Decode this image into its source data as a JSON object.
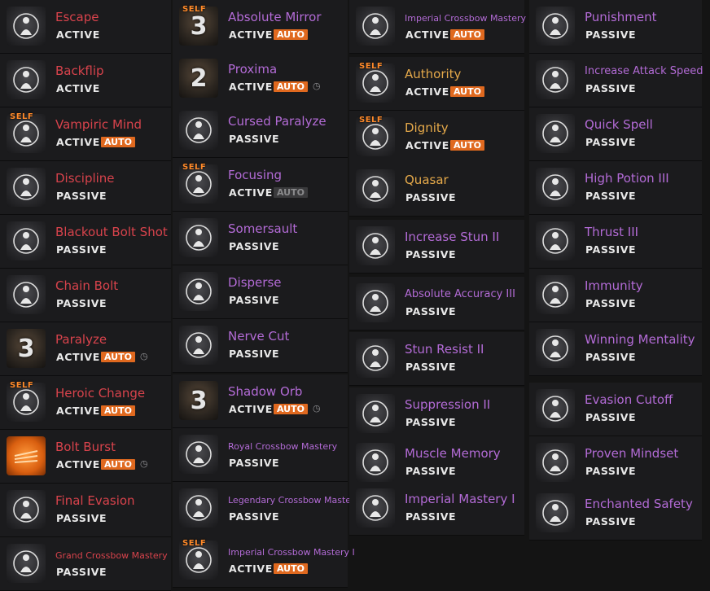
{
  "columns": [
    {
      "skills": [
        {
          "name": "Escape",
          "status": "ACTIVE",
          "color": "red",
          "icon": "escape-icon"
        },
        {
          "name": "Backflip",
          "status": "ACTIVE",
          "color": "red",
          "icon": "backflip-icon"
        },
        {
          "name": "Vampiric Mind",
          "status": "ACTIVE",
          "auto": "AUTO",
          "color": "red",
          "icon": "vampiric-mind-icon",
          "self": "SELF"
        },
        {
          "name": "Discipline",
          "status": "PASSIVE",
          "color": "red",
          "icon": "discipline-icon"
        },
        {
          "name": "Blackout Bolt Shot",
          "status": "PASSIVE",
          "color": "red",
          "icon": "blackout-bolt-icon"
        },
        {
          "name": "Chain Bolt",
          "status": "PASSIVE",
          "color": "red",
          "icon": "chain-bolt-icon"
        },
        {
          "name": "Paralyze",
          "status": "ACTIVE",
          "auto": "AUTO",
          "color": "red",
          "icon": "paralyze-icon",
          "digit": "3",
          "clock": "◷"
        },
        {
          "name": "Heroic Change",
          "status": "ACTIVE",
          "auto": "AUTO",
          "color": "red",
          "icon": "heroic-change-icon",
          "self": "SELF"
        },
        {
          "name": "Bolt Burst",
          "status": "ACTIVE",
          "auto": "AUTO",
          "color": "red",
          "icon": "bolt-burst-icon",
          "clock": "◷",
          "orange": true
        },
        {
          "name": "Final Evasion",
          "status": "PASSIVE",
          "color": "red",
          "icon": "final-evasion-icon"
        },
        {
          "name": "Grand Crossbow Mastery",
          "status": "PASSIVE",
          "color": "red",
          "icon": "grand-crossbow-icon",
          "size": "small"
        }
      ]
    },
    {
      "skills": [
        {
          "name": "Absolute Mirror",
          "status": "ACTIVE",
          "auto": "AUTO",
          "color": "purple",
          "icon": "absolute-mirror-icon",
          "digit": "3",
          "self": "SELF"
        },
        {
          "name": "Proxima",
          "status": "ACTIVE",
          "auto": "AUTO",
          "color": "purple",
          "icon": "proxima-icon",
          "digit": "2",
          "clock": "◷"
        },
        {
          "name": "Cursed Paralyze",
          "status": "PASSIVE",
          "color": "purple",
          "icon": "cursed-paralyze-icon"
        },
        {
          "name": "Focusing",
          "status": "ACTIVE",
          "auto": "AUTO",
          "autoDim": true,
          "color": "purple",
          "icon": "focusing-icon",
          "self": "SELF"
        },
        {
          "name": "Somersault",
          "status": "PASSIVE",
          "color": "purple",
          "icon": "somersault-icon"
        },
        {
          "name": "Disperse",
          "status": "PASSIVE",
          "color": "purple",
          "icon": "disperse-icon"
        },
        {
          "name": "Nerve Cut",
          "status": "PASSIVE",
          "color": "purple",
          "icon": "nerve-cut-icon"
        },
        {
          "name": "Shadow Orb",
          "status": "ACTIVE",
          "auto": "AUTO",
          "color": "purple",
          "icon": "shadow-orb-icon",
          "digit": "3",
          "clock": "◷"
        },
        {
          "name": "Royal Crossbow Mastery",
          "status": "PASSIVE",
          "color": "purple",
          "icon": "royal-crossbow-icon",
          "size": "small"
        },
        {
          "name": "Legendary Crossbow Mastery",
          "status": "PASSIVE",
          "color": "purple",
          "icon": "legendary-crossbow-icon",
          "size": "small"
        },
        {
          "name": "Imperial Crossbow Mastery I",
          "status": "ACTIVE",
          "auto": "AUTO",
          "color": "purple",
          "icon": "imperial-crossbow-icon",
          "size": "small",
          "self": "SELF"
        }
      ]
    },
    {
      "skills": [
        {
          "name": "Imperial Crossbow Mastery II",
          "status": "ACTIVE",
          "auto": "AUTO",
          "color": "purple",
          "icon": "imperial-crossbow-ii-icon",
          "size": "small"
        },
        {
          "name": "Authority",
          "status": "ACTIVE",
          "auto": "AUTO",
          "color": "gold",
          "icon": "authority-icon",
          "self": "SELF"
        },
        {
          "name": "Dignity",
          "status": "ACTIVE",
          "auto": "AUTO",
          "color": "gold",
          "icon": "dignity-icon",
          "self": "SELF"
        },
        {
          "name": "Quasar",
          "status": "PASSIVE",
          "color": "gold",
          "icon": "quasar-icon"
        },
        {
          "name": "Increase Stun II",
          "status": "PASSIVE",
          "color": "purple",
          "icon": "increase-stun-icon"
        },
        {
          "name": "Absolute Accuracy III",
          "status": "PASSIVE",
          "color": "purple",
          "icon": "absolute-accuracy-icon",
          "size": "mid"
        },
        {
          "name": "Stun Resist II",
          "status": "PASSIVE",
          "color": "purple",
          "icon": "stun-resist-icon"
        },
        {
          "name": "Suppression II",
          "status": "PASSIVE",
          "color": "purple",
          "icon": "suppression-icon"
        },
        {
          "name": "Muscle Memory",
          "status": "PASSIVE",
          "color": "purple",
          "icon": "muscle-memory-icon"
        },
        {
          "name": "Imperial Mastery I",
          "status": "PASSIVE",
          "color": "purple",
          "icon": "imperial-mastery-icon"
        }
      ]
    },
    {
      "skills": [
        {
          "name": "Punishment",
          "status": "PASSIVE",
          "color": "purple",
          "icon": "punishment-icon"
        },
        {
          "name": "Increase Attack Speed",
          "status": "PASSIVE",
          "color": "purple",
          "icon": "increase-attack-speed-icon",
          "size": "mid"
        },
        {
          "name": "Quick Spell",
          "status": "PASSIVE",
          "color": "purple",
          "icon": "quick-spell-icon"
        },
        {
          "name": "High Potion III",
          "status": "PASSIVE",
          "color": "purple",
          "icon": "high-potion-icon"
        },
        {
          "name": "Thrust III",
          "status": "PASSIVE",
          "color": "purple",
          "icon": "thrust-icon"
        },
        {
          "name": "Immunity",
          "status": "PASSIVE",
          "color": "purple",
          "icon": "immunity-icon"
        },
        {
          "name": "Winning Mentality",
          "status": "PASSIVE",
          "color": "purple",
          "icon": "winning-mentality-icon"
        },
        {
          "name": "Evasion Cutoff",
          "status": "PASSIVE",
          "color": "purple",
          "icon": "evasion-cutoff-icon"
        },
        {
          "name": "Proven Mindset",
          "status": "PASSIVE",
          "color": "purple",
          "icon": "proven-mindset-icon"
        },
        {
          "name": "Enchanted Safety",
          "status": "PASSIVE",
          "color": "purple",
          "icon": "enchanted-safety-icon"
        }
      ]
    }
  ],
  "colors": {
    "red": "#d8434c",
    "purple": "#b36bd6",
    "gold": "#e5a94a",
    "auto": "#e0691f",
    "selfTag": "#ff8a2a"
  }
}
